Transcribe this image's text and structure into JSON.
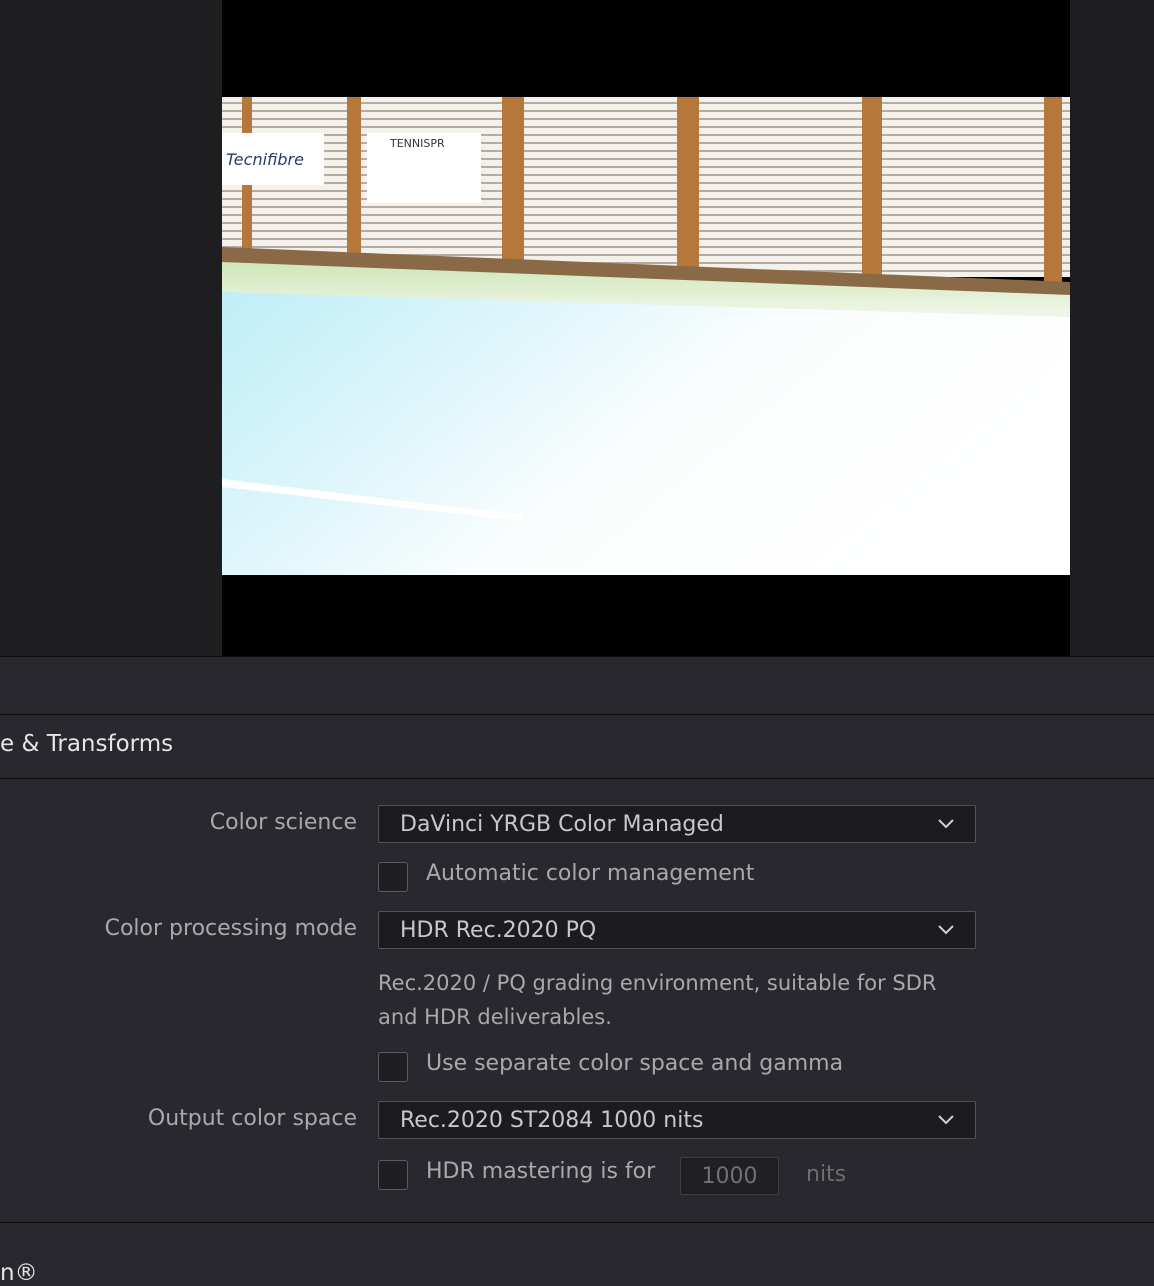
{
  "viewer": {
    "banner_left": "Tecnifibre",
    "banner_right": "TENNISPR"
  },
  "section": {
    "title": "e & Transforms"
  },
  "settings": {
    "color_science": {
      "label": "Color science",
      "value": "DaVinci YRGB Color Managed"
    },
    "auto_color_mgmt": {
      "label": "Automatic color management",
      "checked": false
    },
    "processing_mode": {
      "label": "Color processing mode",
      "value": "HDR Rec.2020 PQ",
      "description": "Rec.2020 / PQ grading environment, suitable for SDR and HDR deliverables."
    },
    "separate_cs": {
      "label": "Use separate color space and gamma",
      "checked": false
    },
    "output_cs": {
      "label": "Output color space",
      "value": "Rec.2020 ST2084 1000 nits"
    },
    "hdr_mastering": {
      "label": "HDR mastering is for",
      "checked": false,
      "value": "1000",
      "unit": "nits"
    }
  },
  "footer": {
    "title": "n®"
  },
  "colors": {
    "panel_bg": "#28282e",
    "viewer_bg": "#1e1e21",
    "dropdown_bg": "#1c1c1f",
    "label": "#a9a9ad",
    "title": "#e6e6e6"
  }
}
